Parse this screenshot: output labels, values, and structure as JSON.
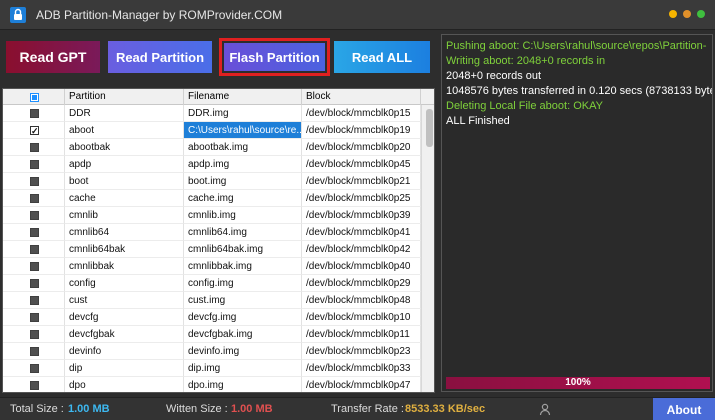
{
  "window": {
    "title": "ADB Partition-Manager by ROMProvider.COM",
    "dots": [
      "#f5b400",
      "#e0902a",
      "#3fbf3f"
    ]
  },
  "toolbar": {
    "read_gpt": "Read GPT",
    "read_partition": "Read Partition",
    "flash_partition": "Flash  Partition",
    "read_all": "Read ALL"
  },
  "table": {
    "headers": [
      "Partition",
      "Filename",
      "Block"
    ],
    "rows": [
      {
        "partition": "DDR",
        "filename": "DDR.img",
        "block": "/dev/block/mmcblk0p15",
        "checked": false
      },
      {
        "partition": "aboot",
        "filename": "C:\\Users\\rahul\\source\\re...",
        "block": "/dev/block/mmcblk0p19",
        "checked": true,
        "selected": true
      },
      {
        "partition": "abootbak",
        "filename": "abootbak.img",
        "block": "/dev/block/mmcblk0p20",
        "checked": false
      },
      {
        "partition": "apdp",
        "filename": "apdp.img",
        "block": "/dev/block/mmcblk0p45",
        "checked": false
      },
      {
        "partition": "boot",
        "filename": "boot.img",
        "block": "/dev/block/mmcblk0p21",
        "checked": false
      },
      {
        "partition": "cache",
        "filename": "cache.img",
        "block": "/dev/block/mmcblk0p25",
        "checked": false
      },
      {
        "partition": "cmnlib",
        "filename": "cmnlib.img",
        "block": "/dev/block/mmcblk0p39",
        "checked": false
      },
      {
        "partition": "cmnlib64",
        "filename": "cmnlib64.img",
        "block": "/dev/block/mmcblk0p41",
        "checked": false
      },
      {
        "partition": "cmnlib64bak",
        "filename": "cmnlib64bak.img",
        "block": "/dev/block/mmcblk0p42",
        "checked": false
      },
      {
        "partition": "cmnlibbak",
        "filename": "cmnlibbak.img",
        "block": "/dev/block/mmcblk0p40",
        "checked": false
      },
      {
        "partition": "config",
        "filename": "config.img",
        "block": "/dev/block/mmcblk0p29",
        "checked": false
      },
      {
        "partition": "cust",
        "filename": "cust.img",
        "block": "/dev/block/mmcblk0p48",
        "checked": false
      },
      {
        "partition": "devcfg",
        "filename": "devcfg.img",
        "block": "/dev/block/mmcblk0p10",
        "checked": false
      },
      {
        "partition": "devcfgbak",
        "filename": "devcfgbak.img",
        "block": "/dev/block/mmcblk0p11",
        "checked": false
      },
      {
        "partition": "devinfo",
        "filename": "devinfo.img",
        "block": "/dev/block/mmcblk0p23",
        "checked": false
      },
      {
        "partition": "dip",
        "filename": "dip.img",
        "block": "/dev/block/mmcblk0p33",
        "checked": false
      },
      {
        "partition": "dpo",
        "filename": "dpo.img",
        "block": "/dev/block/mmcblk0p47",
        "checked": false
      }
    ]
  },
  "log": {
    "lines": [
      {
        "text": "Pushing aboot: C:\\Users\\rahul\\source\\repos\\Partition-",
        "color": "#7fd13b"
      },
      {
        "text": "Writing aboot: 2048+0 records in",
        "color": "#7fd13b"
      },
      {
        "text": "2048+0 records out",
        "color": "#ffffff"
      },
      {
        "text": "1048576 bytes transferred in 0.120 secs (8738133 byte",
        "color": "#ffffff"
      },
      {
        "text": "Deleting Local File aboot: OKAY",
        "color": "#7fd13b"
      },
      {
        "text": "ALL Finished",
        "color": "#ffffff"
      }
    ],
    "progress_label": "100%",
    "progress_fraction": 1.0
  },
  "status": {
    "total_label": "Total Size :",
    "total_value": "1.00 MB",
    "written_label": "Witten Size :",
    "written_value": "1.00 MB",
    "rate_label": "Transfer Rate :",
    "rate_value": "8533.33 KB/sec",
    "about": "About",
    "colors": {
      "total": "#3db8f0",
      "written": "#e05050",
      "rate": "#e0b040"
    }
  }
}
